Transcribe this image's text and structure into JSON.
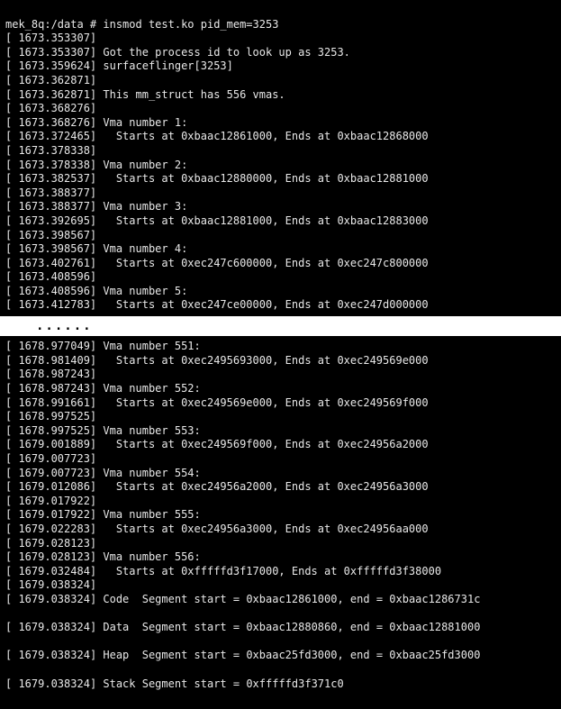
{
  "prompt": "mek_8q:/data # insmod test.ko pid_mem=3253",
  "gap_marker": "......",
  "segments": {
    "code": {
      "ts": "1679.038324",
      "start": "0xbaac12861000",
      "end": "0xbaac1286731c"
    },
    "data": {
      "ts": "1679.038324",
      "start": "0xbaac12880860",
      "end": "0xbaac12881000"
    },
    "heap": {
      "ts": "1679.038324",
      "start": "0xbaac25fd3000",
      "end": "0xbaac25fd3000"
    },
    "stack": {
      "ts": "1679.038324",
      "start": "0xfffffd3f371c0"
    }
  },
  "top": [
    {
      "ts": "1673.353307",
      "txt": ""
    },
    {
      "ts": "1673.353307",
      "txt": "Got the process id to look up as 3253."
    },
    {
      "ts": "1673.359624",
      "txt": "surfaceflinger[3253]"
    },
    {
      "ts": "1673.362871",
      "txt": ""
    },
    {
      "ts": "1673.362871",
      "txt": "This mm_struct has 556 vmas."
    },
    {
      "ts": "1673.368276",
      "txt": ""
    },
    {
      "ts": "1673.368276",
      "txt": "Vma number 1:"
    },
    {
      "ts": "1673.372465",
      "txt": "  Starts at 0xbaac12861000, Ends at 0xbaac12868000"
    },
    {
      "ts": "1673.378338",
      "txt": ""
    },
    {
      "ts": "1673.378338",
      "txt": "Vma number 2:"
    },
    {
      "ts": "1673.382537",
      "txt": "  Starts at 0xbaac12880000, Ends at 0xbaac12881000"
    },
    {
      "ts": "1673.388377",
      "txt": ""
    },
    {
      "ts": "1673.388377",
      "txt": "Vma number 3:"
    },
    {
      "ts": "1673.392695",
      "txt": "  Starts at 0xbaac12881000, Ends at 0xbaac12883000"
    },
    {
      "ts": "1673.398567",
      "txt": ""
    },
    {
      "ts": "1673.398567",
      "txt": "Vma number 4:"
    },
    {
      "ts": "1673.402761",
      "txt": "  Starts at 0xec247c600000, Ends at 0xec247c800000"
    },
    {
      "ts": "1673.408596",
      "txt": ""
    },
    {
      "ts": "1673.408596",
      "txt": "Vma number 5:"
    },
    {
      "ts": "1673.412783",
      "txt": "  Starts at 0xec247ce00000, Ends at 0xec247d000000"
    }
  ],
  "bottom": [
    {
      "ts": "1678.977049",
      "txt": "Vma number 551:"
    },
    {
      "ts": "1678.981409",
      "txt": "  Starts at 0xec2495693000, Ends at 0xec249569e000"
    },
    {
      "ts": "1678.987243",
      "txt": ""
    },
    {
      "ts": "1678.987243",
      "txt": "Vma number 552:"
    },
    {
      "ts": "1678.991661",
      "txt": "  Starts at 0xec249569e000, Ends at 0xec249569f000"
    },
    {
      "ts": "1678.997525",
      "txt": ""
    },
    {
      "ts": "1678.997525",
      "txt": "Vma number 553:"
    },
    {
      "ts": "1679.001889",
      "txt": "  Starts at 0xec249569f000, Ends at 0xec24956a2000"
    },
    {
      "ts": "1679.007723",
      "txt": ""
    },
    {
      "ts": "1679.007723",
      "txt": "Vma number 554:"
    },
    {
      "ts": "1679.012086",
      "txt": "  Starts at 0xec24956a2000, Ends at 0xec24956a3000"
    },
    {
      "ts": "1679.017922",
      "txt": ""
    },
    {
      "ts": "1679.017922",
      "txt": "Vma number 555:"
    },
    {
      "ts": "1679.022283",
      "txt": "  Starts at 0xec24956a3000, Ends at 0xec24956aa000"
    },
    {
      "ts": "1679.028123",
      "txt": ""
    },
    {
      "ts": "1679.028123",
      "txt": "Vma number 556:"
    },
    {
      "ts": "1679.032484",
      "txt": "  Starts at 0xfffffd3f17000, Ends at 0xfffffd3f38000"
    },
    {
      "ts": "1679.038324",
      "txt": ""
    }
  ]
}
